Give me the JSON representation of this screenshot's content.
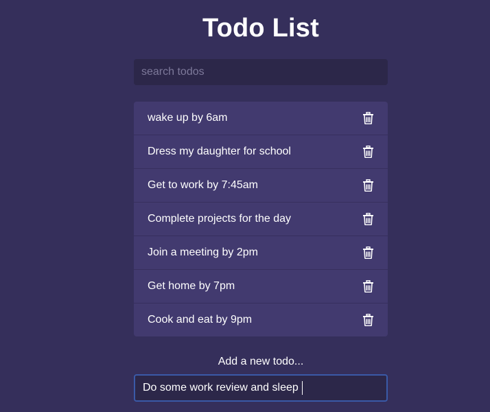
{
  "app": {
    "title": "Todo List"
  },
  "search": {
    "placeholder": "search todos",
    "value": ""
  },
  "todos": [
    {
      "text": "wake up by 6am",
      "icon": "trash-icon"
    },
    {
      "text": "Dress my daughter for school",
      "icon": "trash-icon"
    },
    {
      "text": "Get to work by 7:45am",
      "icon": "trash-icon"
    },
    {
      "text": "Complete projects for the day",
      "icon": "trash-icon"
    },
    {
      "text": "Join a meeting by 2pm",
      "icon": "trash-icon"
    },
    {
      "text": "Get home by 7pm",
      "icon": "trash-icon"
    },
    {
      "text": "Cook and eat by 9pm",
      "icon": "trash-icon"
    }
  ],
  "add": {
    "label": "Add a new todo...",
    "value": "Do some work review and sleep"
  },
  "colors": {
    "background": "#352f5b",
    "input_background": "#2c2749",
    "list_background": "#423a6f",
    "focus_border": "#3a5aa8",
    "text": "#ffffff",
    "placeholder": "#7d799a"
  }
}
